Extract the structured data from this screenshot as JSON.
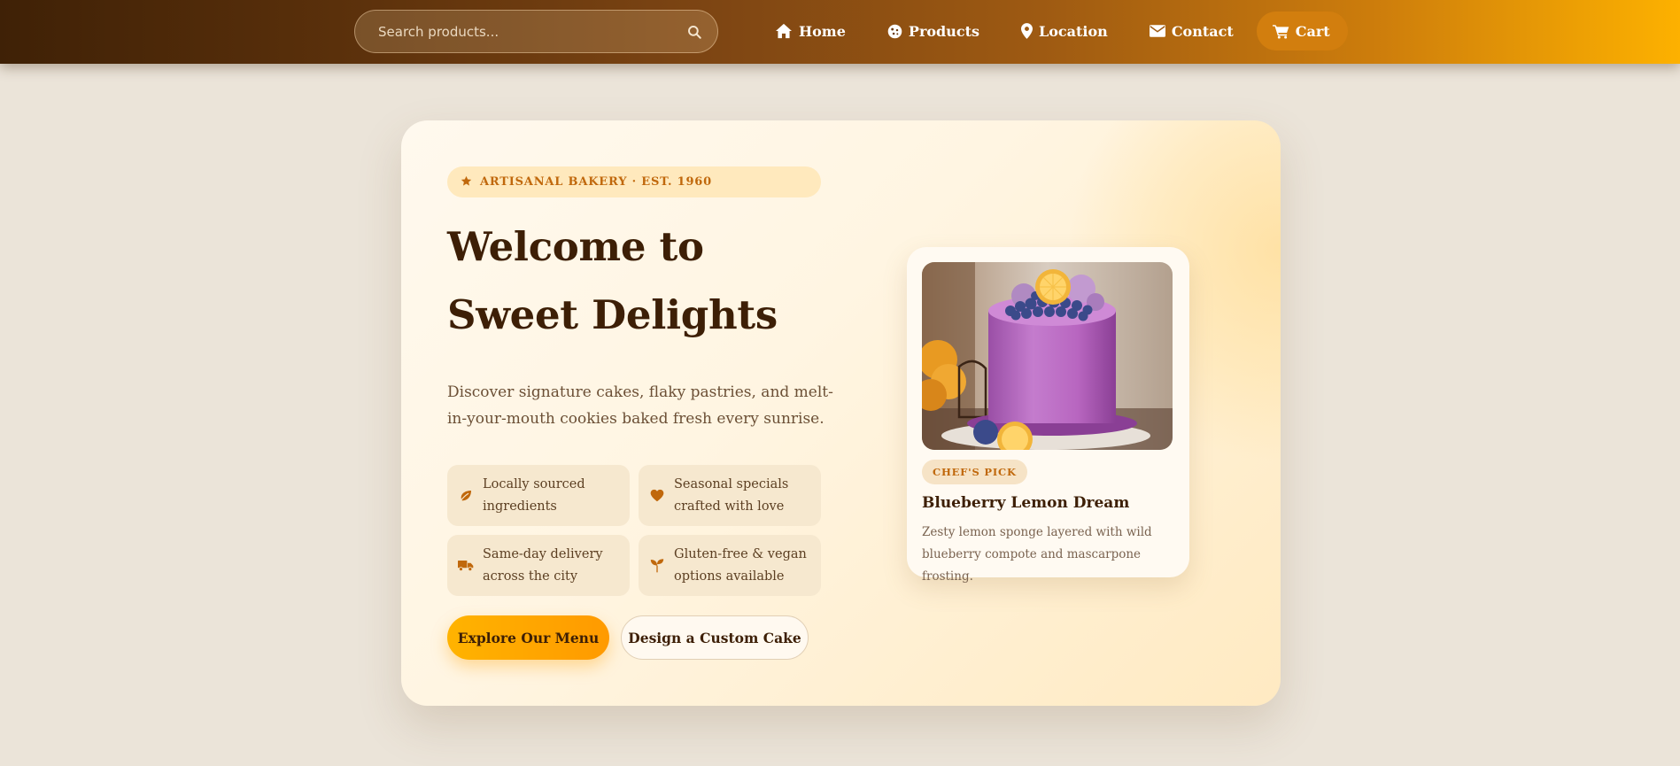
{
  "header": {
    "search": {
      "placeholder": "Search products...",
      "value": ""
    },
    "nav": [
      {
        "label": "Home",
        "icon": "home-icon"
      },
      {
        "label": "Products",
        "icon": "cookie-icon"
      },
      {
        "label": "Location",
        "icon": "map-pin-icon"
      },
      {
        "label": "Contact",
        "icon": "envelope-icon"
      },
      {
        "label": "Cart",
        "icon": "cart-icon"
      }
    ]
  },
  "hero": {
    "badge": "ARTISANAL BAKERY · EST. 1960",
    "title_line1": "Welcome to",
    "title_line2": "Sweet Delights",
    "subtitle": "Discover signature cakes, flaky pastries, and melt-in-your-mouth cookies baked fresh every sunrise.",
    "features": [
      {
        "text": "Locally sourced ingredients",
        "icon": "leaf-icon"
      },
      {
        "text": "Seasonal specials crafted with love",
        "icon": "heart-icon"
      },
      {
        "text": "Same-day delivery across the city",
        "icon": "truck-icon"
      },
      {
        "text": "Gluten-free & vegan options available",
        "icon": "seedling-icon"
      }
    ],
    "primary_button": "Explore Our Menu",
    "secondary_button": "Design a Custom Cake"
  },
  "featured_product": {
    "badge": "CHEF'S PICK",
    "name": "Blueberry Lemon Dream",
    "description": "Zesty lemon sponge layered with wild blueberry compote and mascarpone frosting.",
    "image": "blueberry-lemon-cake"
  },
  "colors": {
    "header_start": "#3f2106",
    "header_end": "#fdb100",
    "accent": "#c0680c",
    "heading": "#3d1f06",
    "page_background": "#ebe4d9",
    "primary_button": "#ffa500"
  }
}
